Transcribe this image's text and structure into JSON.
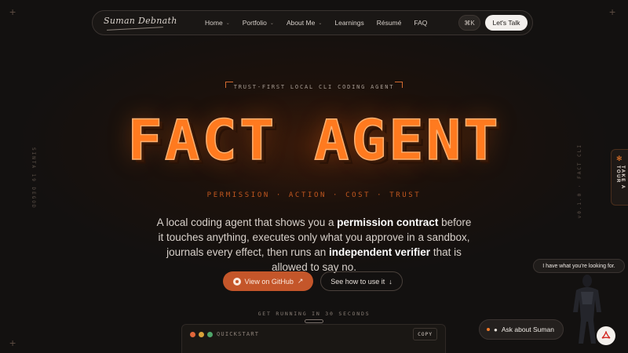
{
  "nav": {
    "logo": "Suman Debnath",
    "links": [
      {
        "label": "Home",
        "dropdown": true
      },
      {
        "label": "Portfolio",
        "dropdown": true
      },
      {
        "label": "About Me",
        "dropdown": true
      },
      {
        "label": "Learnings",
        "dropdown": false
      },
      {
        "label": "Résumé",
        "dropdown": false
      },
      {
        "label": "FAQ",
        "dropdown": false
      }
    ],
    "shortcut": "⌘K",
    "cta": "Let's Talk"
  },
  "hero": {
    "tagline": "TRUST-FIRST LOCAL CLI CODING AGENT",
    "title": "FACT AGENT",
    "subtags": "PERMISSION · ACTION · COST · TRUST",
    "lead": {
      "p1": "A local coding agent that shows you a ",
      "b1": "permission contract",
      "p2": " before it touches anything, executes only what you approve in a sandbox, journals every effect, then runs an ",
      "b2": "independent verifier",
      "p3": " that is allowed to say no."
    },
    "primary_cta": "View on GitHub",
    "primary_cta_icon": "↗",
    "secondary_cta": "See how to use it",
    "secondary_cta_icon": "↓",
    "getting_started": "GET RUNNING IN 30 SECONDS"
  },
  "quickstart": {
    "label": "QUICKSTART",
    "copy": "COPY",
    "dots": [
      "#e0663a",
      "#d9a23a",
      "#4fa66a"
    ]
  },
  "side": {
    "left": "SINTA 19 DEGOD",
    "right": "v0.1.0 · FACT CLI"
  },
  "tour": {
    "label": "TAKE A TOUR",
    "icon": "paw-icon"
  },
  "assistant": {
    "bubble": "I have what you're looking for.",
    "ask": "Ask about Suman"
  },
  "colors": {
    "accent": "#ff7a1f",
    "primary_button": "#c4562a",
    "background": "#131110"
  }
}
